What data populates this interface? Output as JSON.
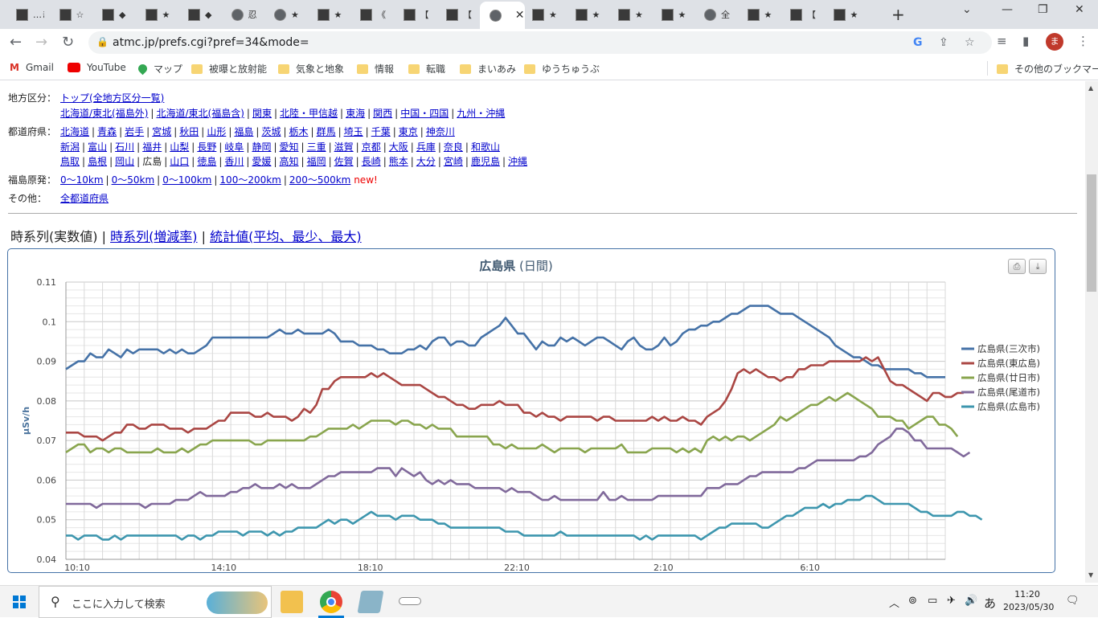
{
  "browser": {
    "tabs": [
      {
        "title": "…き"
      },
      {
        "title": "☆"
      },
      {
        "title": "◆"
      },
      {
        "title": "★"
      },
      {
        "title": "◆"
      },
      {
        "title": "忍"
      },
      {
        "title": "★"
      },
      {
        "title": "★"
      },
      {
        "title": "《"
      },
      {
        "title": "【"
      },
      {
        "title": "【"
      },
      {
        "title": ""
      },
      {
        "title": "★"
      },
      {
        "title": "★"
      },
      {
        "title": "★"
      },
      {
        "title": "★"
      },
      {
        "title": "全"
      },
      {
        "title": "★"
      },
      {
        "title": "【"
      },
      {
        "title": "★"
      }
    ],
    "url": "atmc.jp/prefs.cgi?pref=34&mode=",
    "profile_initial": "ま",
    "bookmarks": [
      "Gmail",
      "YouTube",
      "マップ",
      "被曝と放射能",
      "気象と地象",
      "情報",
      "転職",
      "まいあみ",
      "ゆうちゅうぶ"
    ],
    "other_bookmarks": "その他のブックマーク"
  },
  "nav": {
    "region_label": "地方区分：",
    "region_top": "トップ(全地方区分一覧)",
    "regions": [
      "北海道/東北(福島外)",
      "北海道/東北(福島含)",
      "関東",
      "北陸・甲信越",
      "東海",
      "関西",
      "中国・四国",
      "九州・沖縄"
    ],
    "pref_label": "都道府県：",
    "pref_row1": [
      "北海道",
      "青森",
      "岩手",
      "宮城",
      "秋田",
      "山形",
      "福島",
      "茨城",
      "栃木",
      "群馬",
      "埼玉",
      "千葉",
      "東京",
      "神奈川"
    ],
    "pref_row2": [
      "新潟",
      "富山",
      "石川",
      "福井",
      "山梨",
      "長野",
      "岐阜",
      "静岡",
      "愛知",
      "三重",
      "滋賀",
      "京都",
      "大阪",
      "兵庫",
      "奈良",
      "和歌山"
    ],
    "pref_row3": [
      "鳥取",
      "島根",
      "岡山",
      "広島",
      "山口",
      "徳島",
      "香川",
      "愛媛",
      "高知",
      "福岡",
      "佐賀",
      "長崎",
      "熊本",
      "大分",
      "宮崎",
      "鹿児島",
      "沖縄"
    ],
    "current_pref": "広島",
    "fukushima_label": "福島原発：",
    "fukushima_links": [
      "0〜10km",
      "0〜50km",
      "0〜100km",
      "100〜200km",
      "200〜500km"
    ],
    "new_mark": "new!",
    "other_label": "その他：",
    "other_link": "全都道府県"
  },
  "modes": {
    "current": "時系列(実数値)",
    "links": [
      "時系列(増減率)",
      "統計値(平均、最少、最大)"
    ]
  },
  "chart_data": {
    "type": "line",
    "title_bold": "広島県",
    "title_rest": "(日間)",
    "ylabel": "μSv/h",
    "ylim": [
      0.04,
      0.11
    ],
    "yticks": [
      "0.04",
      "0.05",
      "0.06",
      "0.07",
      "0.08",
      "0.09",
      "0.1",
      "0.11"
    ],
    "xtick_labels": [
      "10:10",
      "14:10",
      "18:10",
      "22:10",
      "2:10",
      "6:10"
    ],
    "grid": true,
    "legend_position": "right",
    "series": [
      {
        "name": "広島県(三次市)",
        "color": "#4572a7",
        "values": [
          0.088,
          0.089,
          0.09,
          0.09,
          0.092,
          0.091,
          0.091,
          0.093,
          0.092,
          0.091,
          0.093,
          0.092,
          0.093,
          0.093,
          0.093,
          0.093,
          0.092,
          0.093,
          0.092,
          0.093,
          0.092,
          0.092,
          0.093,
          0.094,
          0.096,
          0.096,
          0.096,
          0.096,
          0.096,
          0.096,
          0.096,
          0.096,
          0.096,
          0.096,
          0.097,
          0.098,
          0.097,
          0.097,
          0.098,
          0.097,
          0.097,
          0.097,
          0.097,
          0.098,
          0.097,
          0.095,
          0.095,
          0.095,
          0.094,
          0.094,
          0.094,
          0.093,
          0.093,
          0.092,
          0.092,
          0.092,
          0.093,
          0.093,
          0.094,
          0.093,
          0.095,
          0.096,
          0.096,
          0.094,
          0.095,
          0.095,
          0.094,
          0.094,
          0.096,
          0.097,
          0.098,
          0.099,
          0.101,
          0.099,
          0.097,
          0.097,
          0.095,
          0.093,
          0.095,
          0.094,
          0.094,
          0.096,
          0.095,
          0.096,
          0.095,
          0.094,
          0.095,
          0.096,
          0.096,
          0.095,
          0.094,
          0.093,
          0.095,
          0.096,
          0.094,
          0.093,
          0.093,
          0.094,
          0.096,
          0.094,
          0.095,
          0.097,
          0.098,
          0.098,
          0.099,
          0.099,
          0.1,
          0.1,
          0.101,
          0.102,
          0.102,
          0.103,
          0.104,
          0.104,
          0.104,
          0.104,
          0.103,
          0.102,
          0.102,
          0.102,
          0.101,
          0.1,
          0.099,
          0.098,
          0.097,
          0.096,
          0.094,
          0.093,
          0.092,
          0.091,
          0.091,
          0.09,
          0.089,
          0.089,
          0.088,
          0.088,
          0.088,
          0.088,
          0.088,
          0.087,
          0.087,
          0.086,
          0.086,
          0.086,
          0.086
        ]
      },
      {
        "name": "広島県(東広島)",
        "color": "#aa4643",
        "values": [
          0.072,
          0.072,
          0.072,
          0.071,
          0.071,
          0.071,
          0.07,
          0.071,
          0.072,
          0.072,
          0.074,
          0.074,
          0.073,
          0.073,
          0.074,
          0.074,
          0.074,
          0.073,
          0.073,
          0.073,
          0.072,
          0.073,
          0.073,
          0.073,
          0.074,
          0.075,
          0.075,
          0.077,
          0.077,
          0.077,
          0.077,
          0.076,
          0.076,
          0.077,
          0.076,
          0.076,
          0.076,
          0.075,
          0.076,
          0.078,
          0.077,
          0.079,
          0.083,
          0.083,
          0.085,
          0.086,
          0.086,
          0.086,
          0.086,
          0.086,
          0.087,
          0.086,
          0.087,
          0.086,
          0.085,
          0.084,
          0.084,
          0.084,
          0.084,
          0.083,
          0.082,
          0.081,
          0.081,
          0.08,
          0.079,
          0.079,
          0.078,
          0.078,
          0.079,
          0.079,
          0.079,
          0.08,
          0.079,
          0.079,
          0.079,
          0.077,
          0.077,
          0.076,
          0.077,
          0.076,
          0.076,
          0.075,
          0.076,
          0.076,
          0.076,
          0.076,
          0.076,
          0.075,
          0.076,
          0.076,
          0.075,
          0.075,
          0.075,
          0.075,
          0.075,
          0.075,
          0.076,
          0.075,
          0.076,
          0.075,
          0.075,
          0.076,
          0.075,
          0.075,
          0.074,
          0.076,
          0.077,
          0.078,
          0.08,
          0.083,
          0.087,
          0.088,
          0.087,
          0.088,
          0.087,
          0.086,
          0.086,
          0.085,
          0.086,
          0.086,
          0.088,
          0.088,
          0.089,
          0.089,
          0.089,
          0.09,
          0.09,
          0.09,
          0.09,
          0.09,
          0.09,
          0.091,
          0.09,
          0.091,
          0.088,
          0.085,
          0.084,
          0.084,
          0.083,
          0.082,
          0.081,
          0.08,
          0.082,
          0.082,
          0.081,
          0.081,
          0.082,
          0.082
        ]
      },
      {
        "name": "広島県(廿日市)",
        "color": "#89a54e",
        "values": [
          0.067,
          0.068,
          0.069,
          0.069,
          0.067,
          0.068,
          0.068,
          0.067,
          0.068,
          0.068,
          0.067,
          0.067,
          0.067,
          0.067,
          0.067,
          0.068,
          0.067,
          0.067,
          0.067,
          0.068,
          0.067,
          0.068,
          0.069,
          0.069,
          0.07,
          0.07,
          0.07,
          0.07,
          0.07,
          0.07,
          0.07,
          0.069,
          0.069,
          0.07,
          0.07,
          0.07,
          0.07,
          0.07,
          0.07,
          0.07,
          0.071,
          0.071,
          0.072,
          0.073,
          0.073,
          0.073,
          0.073,
          0.074,
          0.073,
          0.074,
          0.075,
          0.075,
          0.075,
          0.075,
          0.074,
          0.075,
          0.075,
          0.074,
          0.074,
          0.073,
          0.074,
          0.073,
          0.073,
          0.073,
          0.071,
          0.071,
          0.071,
          0.071,
          0.071,
          0.071,
          0.069,
          0.069,
          0.068,
          0.069,
          0.068,
          0.068,
          0.068,
          0.068,
          0.069,
          0.068,
          0.067,
          0.068,
          0.068,
          0.068,
          0.068,
          0.067,
          0.068,
          0.068,
          0.068,
          0.068,
          0.068,
          0.069,
          0.067,
          0.067,
          0.067,
          0.067,
          0.068,
          0.068,
          0.068,
          0.068,
          0.067,
          0.068,
          0.067,
          0.068,
          0.067,
          0.07,
          0.071,
          0.07,
          0.071,
          0.07,
          0.071,
          0.071,
          0.07,
          0.071,
          0.072,
          0.073,
          0.074,
          0.076,
          0.075,
          0.076,
          0.077,
          0.078,
          0.079,
          0.079,
          0.08,
          0.081,
          0.08,
          0.081,
          0.082,
          0.081,
          0.08,
          0.079,
          0.078,
          0.076,
          0.076,
          0.076,
          0.075,
          0.075,
          0.073,
          0.074,
          0.075,
          0.076,
          0.076,
          0.074,
          0.074,
          0.073,
          0.071
        ]
      },
      {
        "name": "広島県(尾道市)",
        "color": "#80699b",
        "values": [
          0.054,
          0.054,
          0.054,
          0.054,
          0.054,
          0.053,
          0.054,
          0.054,
          0.054,
          0.054,
          0.054,
          0.054,
          0.054,
          0.053,
          0.054,
          0.054,
          0.054,
          0.054,
          0.055,
          0.055,
          0.055,
          0.056,
          0.057,
          0.056,
          0.056,
          0.056,
          0.056,
          0.057,
          0.057,
          0.058,
          0.058,
          0.059,
          0.058,
          0.058,
          0.058,
          0.059,
          0.058,
          0.059,
          0.058,
          0.058,
          0.058,
          0.059,
          0.06,
          0.061,
          0.061,
          0.062,
          0.062,
          0.062,
          0.062,
          0.062,
          0.062,
          0.063,
          0.063,
          0.063,
          0.061,
          0.063,
          0.062,
          0.061,
          0.062,
          0.06,
          0.059,
          0.06,
          0.059,
          0.06,
          0.059,
          0.059,
          0.059,
          0.058,
          0.058,
          0.058,
          0.058,
          0.058,
          0.057,
          0.058,
          0.057,
          0.057,
          0.057,
          0.056,
          0.055,
          0.055,
          0.056,
          0.055,
          0.055,
          0.055,
          0.055,
          0.055,
          0.055,
          0.055,
          0.057,
          0.055,
          0.055,
          0.056,
          0.055,
          0.055,
          0.055,
          0.055,
          0.055,
          0.056,
          0.056,
          0.056,
          0.056,
          0.056,
          0.056,
          0.056,
          0.056,
          0.058,
          0.058,
          0.058,
          0.059,
          0.059,
          0.059,
          0.06,
          0.061,
          0.061,
          0.062,
          0.062,
          0.062,
          0.062,
          0.062,
          0.062,
          0.063,
          0.063,
          0.064,
          0.065,
          0.065,
          0.065,
          0.065,
          0.065,
          0.065,
          0.065,
          0.066,
          0.066,
          0.067,
          0.069,
          0.07,
          0.071,
          0.073,
          0.073,
          0.072,
          0.07,
          0.07,
          0.068,
          0.068,
          0.068,
          0.068,
          0.068,
          0.067,
          0.066,
          0.067
        ]
      },
      {
        "name": "広島県(広島市)",
        "color": "#3d96ae",
        "values": [
          0.046,
          0.046,
          0.045,
          0.046,
          0.046,
          0.046,
          0.045,
          0.045,
          0.046,
          0.045,
          0.046,
          0.046,
          0.046,
          0.046,
          0.046,
          0.046,
          0.046,
          0.046,
          0.046,
          0.045,
          0.046,
          0.046,
          0.045,
          0.046,
          0.046,
          0.047,
          0.047,
          0.047,
          0.047,
          0.046,
          0.047,
          0.047,
          0.047,
          0.046,
          0.047,
          0.046,
          0.047,
          0.047,
          0.048,
          0.048,
          0.048,
          0.048,
          0.049,
          0.05,
          0.049,
          0.05,
          0.05,
          0.049,
          0.05,
          0.051,
          0.052,
          0.051,
          0.051,
          0.051,
          0.05,
          0.051,
          0.051,
          0.051,
          0.05,
          0.05,
          0.05,
          0.049,
          0.049,
          0.048,
          0.048,
          0.048,
          0.048,
          0.048,
          0.048,
          0.048,
          0.048,
          0.048,
          0.047,
          0.047,
          0.047,
          0.046,
          0.046,
          0.046,
          0.046,
          0.046,
          0.046,
          0.047,
          0.046,
          0.046,
          0.046,
          0.046,
          0.046,
          0.046,
          0.046,
          0.046,
          0.046,
          0.046,
          0.046,
          0.046,
          0.045,
          0.046,
          0.045,
          0.046,
          0.046,
          0.046,
          0.046,
          0.046,
          0.046,
          0.046,
          0.045,
          0.046,
          0.047,
          0.048,
          0.048,
          0.049,
          0.049,
          0.049,
          0.049,
          0.049,
          0.048,
          0.048,
          0.049,
          0.05,
          0.051,
          0.051,
          0.052,
          0.053,
          0.053,
          0.053,
          0.054,
          0.053,
          0.054,
          0.054,
          0.055,
          0.055,
          0.055,
          0.056,
          0.056,
          0.055,
          0.054,
          0.054,
          0.054,
          0.054,
          0.054,
          0.053,
          0.052,
          0.052,
          0.051,
          0.051,
          0.051,
          0.051,
          0.052,
          0.052,
          0.051,
          0.051,
          0.05
        ]
      }
    ]
  },
  "taskbar": {
    "search_placeholder": "ここに入力して検索",
    "ime": "あ",
    "time": "11:20",
    "date": "2023/05/30"
  }
}
